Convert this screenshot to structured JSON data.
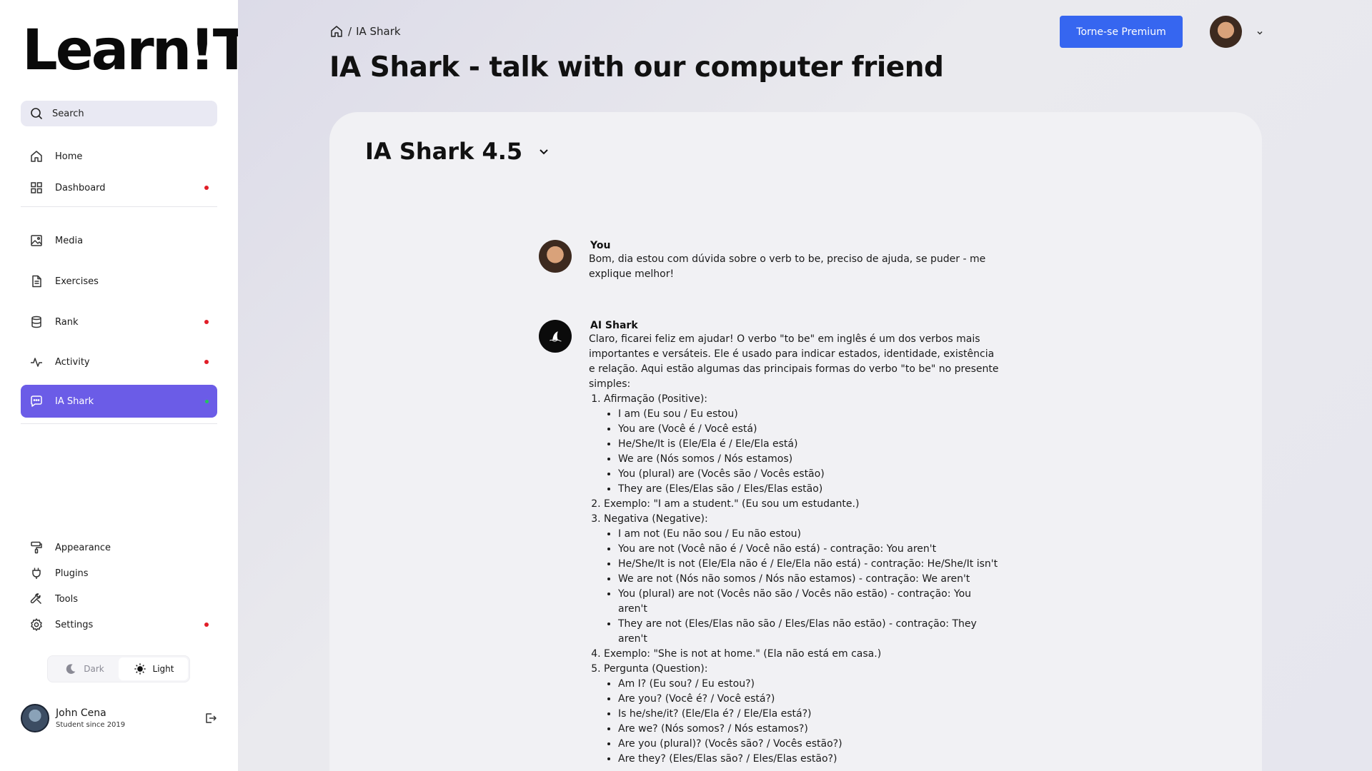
{
  "sidebar": {
    "logo": "Learn!T",
    "search_label": "Search",
    "nav_top": [
      {
        "label": "Home",
        "icon": "home-icon",
        "dot": false
      },
      {
        "label": "Dashboard",
        "icon": "grid-icon",
        "dot": true
      }
    ],
    "nav_mid": [
      {
        "label": "Media",
        "icon": "image-icon",
        "dot": false
      },
      {
        "label": "Exercises",
        "icon": "document-icon",
        "dot": false
      },
      {
        "label": "Rank",
        "icon": "database-icon",
        "dot": true
      },
      {
        "label": "Activity",
        "icon": "activity-icon",
        "dot": true
      },
      {
        "label": "IA Shark",
        "icon": "chat-icon",
        "dot": true,
        "active": true
      }
    ],
    "nav_bottom": [
      {
        "label": "Appearance",
        "icon": "paint-roller-icon",
        "dot": false
      },
      {
        "label": "Plugins",
        "icon": "plug-icon",
        "dot": false
      },
      {
        "label": "Tools",
        "icon": "wrench-icon",
        "dot": false
      },
      {
        "label": "Settings",
        "icon": "gear-icon",
        "dot": true
      }
    ],
    "theme": {
      "dark_label": "Dark",
      "light_label": "Light",
      "selected": "Light"
    },
    "profile": {
      "name": "John Cena",
      "subtitle": "Student since 2019"
    }
  },
  "header": {
    "breadcrumb_sep": "/",
    "breadcrumb_current": "IA Shark",
    "title": "IA Shark - talk with our computer friend",
    "premium_label": "Torne-se Premium"
  },
  "chat": {
    "model_name": "IA Shark 4.5",
    "user_message": {
      "author": "You",
      "text": "Bom, dia estou com dúvida sobre o verb to be, preciso de ajuda, se puder - me explique melhor!"
    },
    "ai_message": {
      "author": "AI Shark",
      "intro": "Claro, ficarei feliz em ajudar! O verbo \"to be\" em inglês é um dos verbos mais importantes e versáteis. Ele é usado para indicar estados, identidade, existência e relação. Aqui estão algumas das principais formas do verbo \"to be\" no presente simples:",
      "sections": [
        {
          "text": "Afirmação (Positive):",
          "items": [
            "I am (Eu sou / Eu estou)",
            "You are (Você é / Você está)",
            "He/She/It is (Ele/Ela é / Ele/Ela está)",
            "We are (Nós somos / Nós estamos)",
            "You (plural) are (Vocês são / Vocês estão)",
            "They are (Eles/Elas são / Eles/Elas estão)"
          ]
        },
        {
          "text": "Exemplo: \"I am a student.\" (Eu sou um estudante.)",
          "items": []
        },
        {
          "text": "Negativa (Negative):",
          "items": [
            "I am not (Eu não sou / Eu não estou)",
            "You are not (Você não é / Você não está) - contração: You aren't",
            "He/She/It is not (Ele/Ela não é / Ele/Ela não está) - contração: He/She/It isn't",
            "We are not (Nós não somos / Nós não estamos) - contração: We aren't",
            "You (plural) are not (Vocês não são / Vocês não estão) - contração: You aren't",
            "They are not (Eles/Elas não são / Eles/Elas não estão) - contração: They aren't"
          ]
        },
        {
          "text": "Exemplo: \"She is not at home.\" (Ela não está em casa.)",
          "items": []
        },
        {
          "text": "Pergunta (Question):",
          "items": [
            "Am I? (Eu sou? / Eu estou?)",
            "Are you? (Você é? / Você está?)",
            "Is he/she/it? (Ele/Ela é? / Ele/Ela está?)",
            "Are we? (Nós somos? / Nós estamos?)",
            "Are you (plural)? (Vocês são? / Vocês estão?)",
            "Are they? (Eles/Elas são? / Eles/Elas estão?)"
          ]
        }
      ]
    }
  },
  "colors": {
    "accent": "#6b5ce7",
    "premium": "#3666f0",
    "dot_red": "#e11d27",
    "dot_green": "#22c55e"
  }
}
